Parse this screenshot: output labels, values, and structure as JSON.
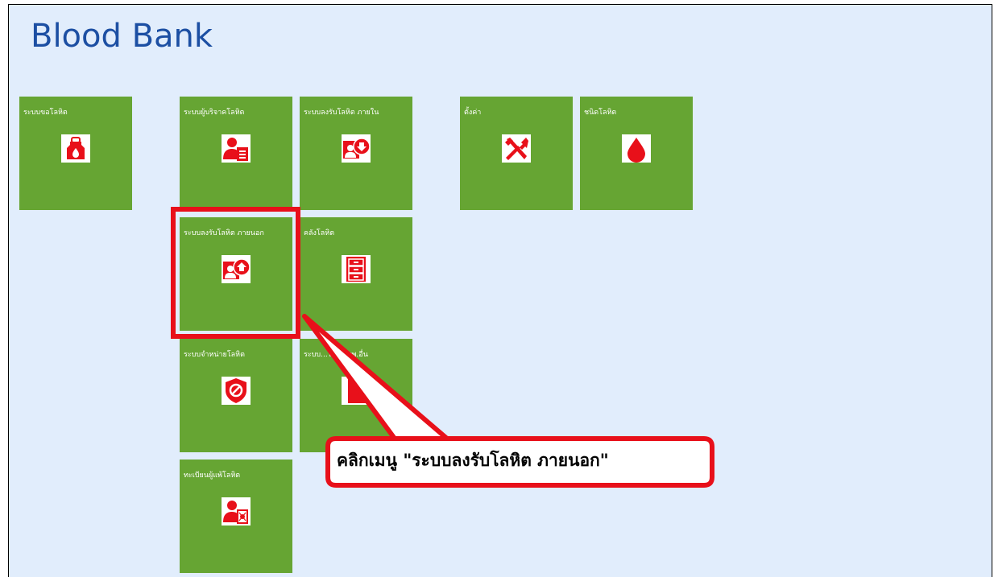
{
  "app": {
    "title": "Blood Bank"
  },
  "tiles": [
    {
      "label": "ระบบขอโลหิต",
      "icon": "blood-bag-icon"
    },
    {
      "label": "ระบบผู้บริจาคโลหิต",
      "icon": "donor-document-icon"
    },
    {
      "label": "ระบบลงรับโลหิต ภายใน",
      "icon": "user-receive-icon"
    },
    {
      "label": "ตั้งค่า",
      "icon": "tools-icon"
    },
    {
      "label": "ชนิดโลหิต",
      "icon": "blood-drop-icon"
    },
    {
      "label": "ระบบลงรับโลหิต ภายนอก",
      "icon": "user-upload-icon"
    },
    {
      "label": "คลังโลหิต",
      "icon": "cabinet-icon"
    },
    {
      "label": "ระบบจำหน่ายโลหิต",
      "icon": "shield-block-icon"
    },
    {
      "label": "ระบบ...โลหิต รพ.อื่น",
      "icon": "document-icon"
    },
    {
      "label": "ทะเบียนผู้แพ้โลหิต",
      "icon": "user-allergy-icon"
    }
  ],
  "callout": {
    "text": "คลิกเมนู \"ระบบลงรับโลหิต ภายนอก\""
  },
  "colors": {
    "tile": "#66a533",
    "icon": "#e8101a",
    "title": "#1c4fa3",
    "background": "#e1edfc",
    "highlight": "#e8101a"
  }
}
